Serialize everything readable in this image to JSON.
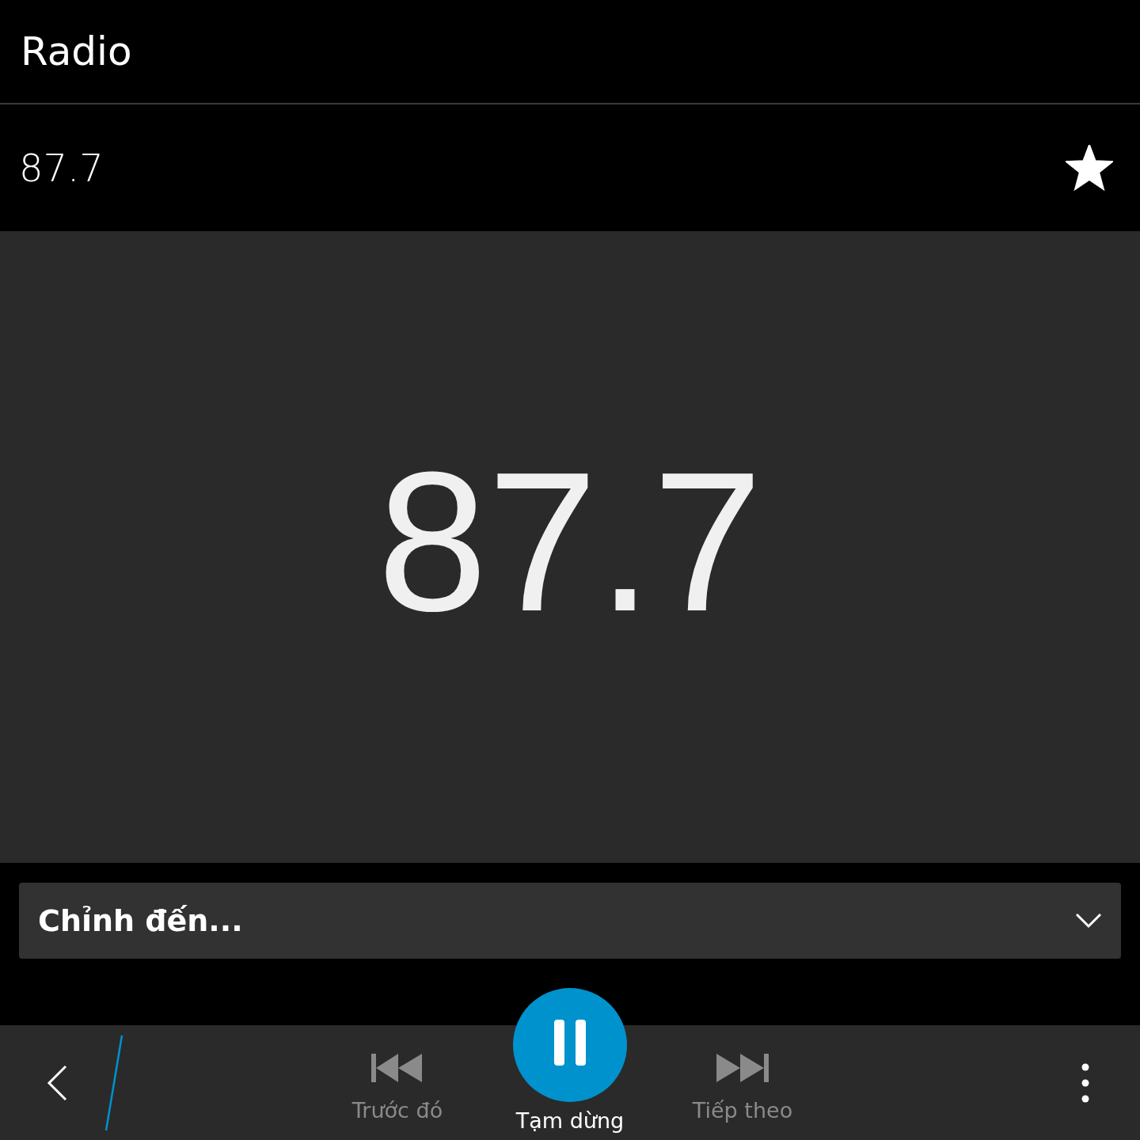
{
  "title": "Radio",
  "station": {
    "frequency": "87.7",
    "favorite": true
  },
  "display": {
    "frequency": "87.7"
  },
  "tune_dropdown": {
    "label": "Chỉnh đến..."
  },
  "actions": [
    {
      "kind": "previous",
      "label": "Trước đó"
    },
    {
      "kind": "pause",
      "label": "Tạm dừng"
    },
    {
      "kind": "next",
      "label": "Tiếp theo"
    }
  ]
}
